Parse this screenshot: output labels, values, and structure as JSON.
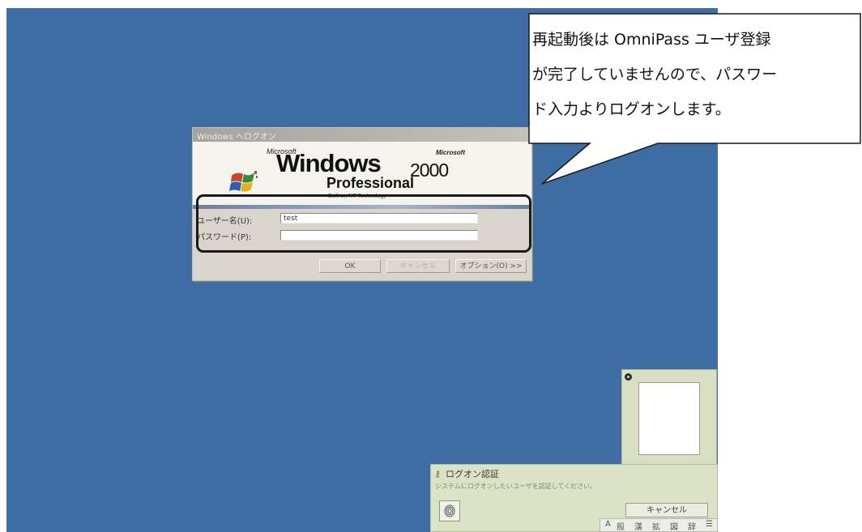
{
  "callout": {
    "lines": [
      "再起動後は OmniPass ユーザ登録",
      "が完了していませんので、パスワー",
      "ド入力よりログオンします。"
    ]
  },
  "logon_dialog": {
    "title": "Windows へログオン",
    "branding": {
      "microsoft_small": "Microsoft",
      "microsoft_right": "Microsoft",
      "windows": "Windows",
      "version": "2000",
      "edition": "Professional",
      "built_on": "Built on NT Technology"
    },
    "username_label": "ユーザー名(U):",
    "username_value": "test",
    "password_label": "パスワード(P):",
    "password_value": "",
    "ok_label": "OK",
    "cancel_label": "キャンセル",
    "options_label": "オプション(O) >>"
  },
  "fingerprint_panel": {
    "camera_icon": "camera-icon"
  },
  "auth_panel": {
    "title": "ログオン認証",
    "message": "システムにログオンしたいユーザを認証してください。",
    "cancel_label": "キャンセル"
  },
  "ime_bar": {
    "items": [
      "A",
      "般",
      "漢",
      "拡",
      "図",
      "辞"
    ]
  },
  "colors": {
    "desktop": "#3e6da4",
    "dialog": "#d9d5cc",
    "panel": "#dbe2c6"
  }
}
